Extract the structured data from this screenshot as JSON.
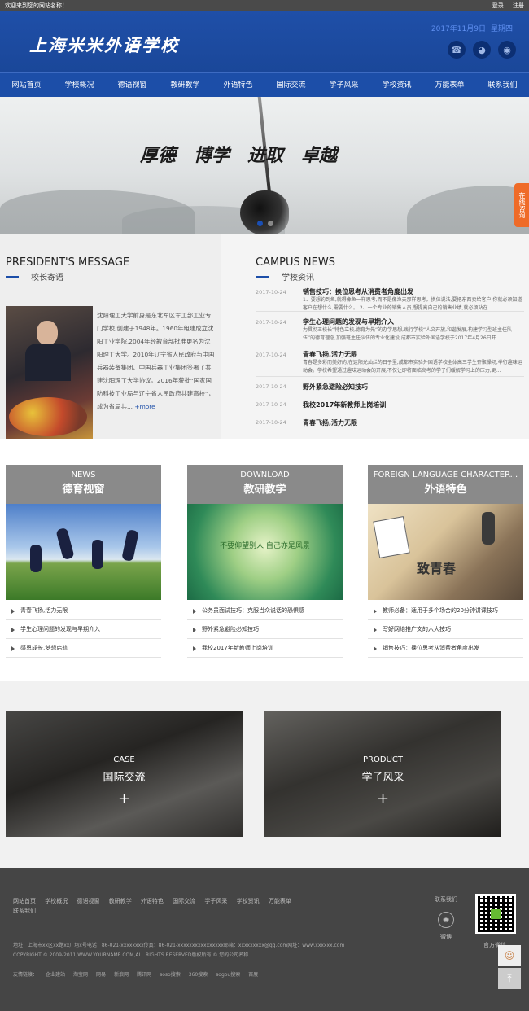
{
  "topbar": {
    "welcome": "欢迎来到您的网站名称！",
    "login": "登录",
    "register": "注册"
  },
  "header": {
    "logo": "上海米米外语学校",
    "date": "2017年11月9日",
    "weekday": "星期四",
    "icons": [
      "phone-icon",
      "wechat-icon",
      "weibo-icon"
    ]
  },
  "nav": [
    "网站首页",
    "学校概况",
    "德语视窗",
    "教研教学",
    "外语特色",
    "国际交流",
    "学子风采",
    "学校资讯",
    "万能表单",
    "联系我们"
  ],
  "banner": {
    "motto": [
      "厚德",
      "博学",
      "进取",
      "卓越"
    ],
    "side_button": "在线咨询"
  },
  "president": {
    "title_en": "PRESIDENT'S MESSAGE",
    "title_cn": "校长寄语",
    "text": "沈阳理工大学前身是东北军区军工部工业专门学校,创建于1948年。1960年组建成立沈阳工业学院,2004年经教育部批准更名为沈阳理工大学。2010年辽宁省人民政府与中国兵器装备集团、中国兵器工业集团签署了共建沈阳理工大学协议。2016年获批“国家国防科技工业局与辽宁省人民政府共建高校”，成为省局共...",
    "more": "+more"
  },
  "campus_news": {
    "title_en": "CAMPUS NEWS",
    "title_cn": "学校资讯",
    "items": [
      {
        "date": "2017-10-24",
        "title": "销售技巧：换位思考从消费者角度出发",
        "desc": "1、要想钓到鱼,就得像鱼一样思考,而不是像渔夫那样思考。换位说法,要把东西卖给客户,你就必须知道客户在想什么,需要什么。 2、一个专业的销售人员,想提高自己的销售业绩,就必须站在..."
      },
      {
        "date": "2017-10-24",
        "title": "学生心理问题的发现与早期介入",
        "desc": "为贯彻王校长“特色立校,德育为先”的办学思想,践行学校“人文开放,和谐发展,构建学习型班主任队伍”的德育理念,加强班主任队伍的专业化建设,成都市实验外国语学校于2017年4月26日开..."
      },
      {
        "date": "2017-10-24",
        "title": "青春飞扬,活力无限",
        "desc": "青春是多彩而美好的,在这阳光灿烂的日子里,成都市实验外国语学校全体高三学生齐聚操场,举行趣味运动会。学校希望通过趣味运动会的开展,不仅让即将面临高考的学子们缓解学习上的压力,更..."
      },
      {
        "date": "2017-10-24",
        "title": "野外紧急避险必知技巧",
        "desc": ""
      },
      {
        "date": "2017-10-24",
        "title": "我校2017年新教师上岗培训",
        "desc": ""
      },
      {
        "date": "2017-10-24",
        "title": "青春飞扬,活力无限",
        "desc": ""
      }
    ]
  },
  "cards": [
    {
      "en": "NEWS",
      "cn": "德育视窗",
      "items": [
        "青春飞扬,活力无限",
        "学生心理问题的发现与早期介入",
        "感恩成长,梦想启航"
      ]
    },
    {
      "en": "DOWNLOAD",
      "cn": "教研教学",
      "pic_text": "不要仰望别人 自己亦是风景",
      "items": [
        "公务员面试技巧：克服当众说话的恐惧感",
        "野外紧急避险必知技巧",
        "我校2017年新教师上岗培训"
      ]
    },
    {
      "en": "FOREIGN LANGUAGE CHARACTER...",
      "cn": "外语特色",
      "pic_text": "致青春",
      "items": [
        "教师必备：适用于多个场合的20分钟讲课技巧",
        "写好网络推广文的六大技巧",
        "销售技巧：换位思考从消费者角度出发"
      ]
    }
  ],
  "tiles": [
    {
      "en": "CASE",
      "cn": "国际交流",
      "plus": "+"
    },
    {
      "en": "PRODUCT",
      "cn": "学子风采",
      "plus": "+"
    }
  ],
  "footer": {
    "nav": [
      "网站首页",
      "学校概况",
      "德语视窗",
      "教研教学",
      "外语特色",
      "国际交流",
      "学子风采",
      "学校资讯",
      "万能表单",
      "联系我们"
    ],
    "address": "地址：上海市xx区xx路xx广场x号电话：86-021-xxxxxxxx传真：86-021-xxxxxxxxxxxxxxxx邮箱：xxxxxxxxx@qq.com网址：www.xxxxxx.com",
    "copyright": "COPYRIGHT © 2009-2011,WWW.YOURNAME.COM,ALL RIGHTS RESERVED版权所有 © 您的公司名称",
    "friends_label": "友情链接：",
    "friends": [
      "企业建站",
      "淘宝网",
      "网易",
      "新浪网",
      "腾讯网",
      "soso搜索",
      "360搜索",
      "sogou搜索",
      "百度"
    ],
    "contact_label": "联系我们",
    "weibo_label": "微博",
    "qr_label": "官方微信"
  }
}
